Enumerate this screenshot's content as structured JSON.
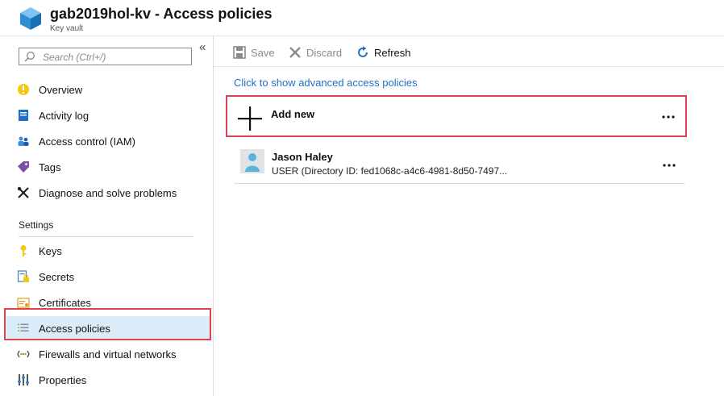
{
  "header": {
    "title": "gab2019hol-kv - Access policies",
    "subtitle": "Key vault",
    "logo_icon": "key-vault-cube-icon"
  },
  "sidebar": {
    "collapse_glyph": "«",
    "search_placeholder": "Search (Ctrl+/)",
    "items": [
      {
        "label": "Overview",
        "icon": "overview-icon"
      },
      {
        "label": "Activity log",
        "icon": "activity-log-icon"
      },
      {
        "label": "Access control (IAM)",
        "icon": "iam-icon"
      },
      {
        "label": "Tags",
        "icon": "tag-icon"
      },
      {
        "label": "Diagnose and solve problems",
        "icon": "wrench-icon"
      }
    ],
    "settings_label": "Settings",
    "settings_items": [
      {
        "label": "Keys",
        "icon": "key-icon"
      },
      {
        "label": "Secrets",
        "icon": "secret-icon"
      },
      {
        "label": "Certificates",
        "icon": "certificate-icon"
      },
      {
        "label": "Access policies",
        "icon": "list-icon",
        "selected": true
      },
      {
        "label": "Firewalls and virtual networks",
        "icon": "network-icon"
      },
      {
        "label": "Properties",
        "icon": "properties-icon"
      }
    ]
  },
  "toolbar": {
    "save_label": "Save",
    "discard_label": "Discard",
    "refresh_label": "Refresh"
  },
  "main": {
    "advanced_link": "Click to show advanced access policies",
    "add_new_label": "Add new",
    "more_glyph": "...",
    "policies": [
      {
        "name": "Jason Haley",
        "detail": "USER (Directory ID: fed1068c-a4c6-4981-8d50-7497..."
      }
    ]
  },
  "colors": {
    "accent": "#1f6fc5",
    "highlight": "#e0414f",
    "selected_bg": "#dcebf8"
  }
}
